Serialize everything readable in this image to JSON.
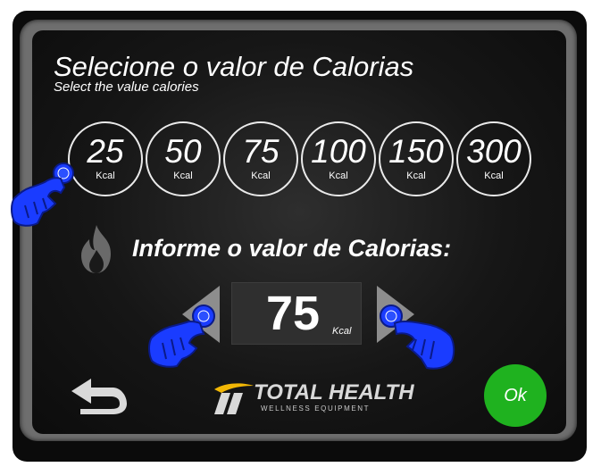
{
  "title": "Selecione o valor de Calorias",
  "subtitle": "Select the value calories",
  "options": [
    {
      "value": "25",
      "unit": "Kcal"
    },
    {
      "value": "50",
      "unit": "Kcal"
    },
    {
      "value": "75",
      "unit": "Kcal"
    },
    {
      "value": "100",
      "unit": "Kcal"
    },
    {
      "value": "150",
      "unit": "Kcal"
    },
    {
      "value": "300",
      "unit": "Kcal"
    }
  ],
  "prompt": "Informe o valor de Calorias:",
  "current": {
    "value": "75",
    "unit": "Kcal"
  },
  "logo": {
    "name": "TOTAL HEALTH",
    "tagline": "WELLNESS EQUIPMENT"
  },
  "ok_label": "Ok",
  "colors": {
    "ok": "#1fb21f",
    "hand": "#1a3cff",
    "accent_logo": "#f2b705"
  },
  "icons": [
    "flame-icon",
    "back-arrow-icon",
    "left-arrow-icon",
    "right-arrow-icon",
    "hand-pointer-icon",
    "logo-icon"
  ]
}
